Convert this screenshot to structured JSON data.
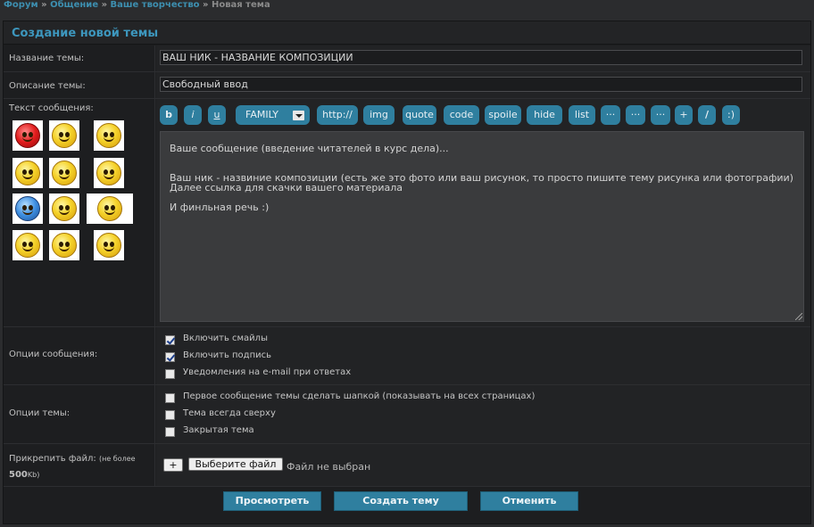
{
  "breadcrumb": {
    "items": [
      "Форум",
      "Общение",
      "Ваше творчество"
    ],
    "separator": "»",
    "current": "Новая тема"
  },
  "form": {
    "title": "Создание новой темы",
    "topic_name": {
      "label": "Название темы:",
      "value": "ВАШ НИК - НАЗВАНИЕ КОМПОЗИЦИИ"
    },
    "topic_desc": {
      "label": "Описание темы:",
      "value": "Свободный ввод"
    },
    "message": {
      "label": "Текст сообщения:",
      "value": "Ваше сообщение (введение читателей в курс дела)...\n\n\nВаш ник - назвиние композиции (есть же это фото или ваш рисунок, то просто пишите тему рисунка или фотографии)\nДалее ссылка для скачки вашего материала\n\nИ финльная речь :)"
    },
    "toolbar": [
      "b",
      "i",
      "u",
      "FAMILY",
      "http://",
      "img",
      "quote",
      "code",
      "spoile",
      "hide",
      "list",
      "···",
      "···",
      "···",
      "+",
      "/",
      ":)"
    ],
    "smileys": [
      "angry-smiley-icon",
      "happy-smiley-icon",
      "sly-smiley-icon",
      "crying-smiley-icon",
      "surprised-smiley-icon",
      "laughing-smiley-icon",
      "cold-smiley-icon",
      "blushing-smiley-icon",
      "shocked-smiley-icon",
      "lol-smiley-icon",
      "dizzy-smiley-icon",
      "sad-smiley-icon"
    ],
    "message_options": {
      "label": "Опции сообщения:",
      "items": [
        {
          "label": "Включить смайлы",
          "checked": true
        },
        {
          "label": "Включить подпись",
          "checked": true
        },
        {
          "label": "Уведомления на e-mail при ответах",
          "checked": false
        }
      ]
    },
    "topic_options": {
      "label": "Опции темы:",
      "items": [
        {
          "label": "Первое сообщение темы сделать шапкой (показывать на всех страницах)",
          "checked": false
        },
        {
          "label": "Тема всегда сверху",
          "checked": false
        },
        {
          "label": "Закрытая тема",
          "checked": false
        }
      ]
    },
    "attach": {
      "label": "Прикрепить файл:",
      "note": "(не более",
      "size": "500",
      "unit": "Kb)",
      "add_label": "+",
      "choose_label": "Выберите файл",
      "status": "Файл не выбран"
    },
    "buttons": {
      "preview": "Просмотреть",
      "create": "Создать тему",
      "cancel": "Отменить"
    }
  },
  "colors": {
    "accent": "#2f7f9f",
    "title": "#3d97be",
    "background": "#1d1e20"
  }
}
